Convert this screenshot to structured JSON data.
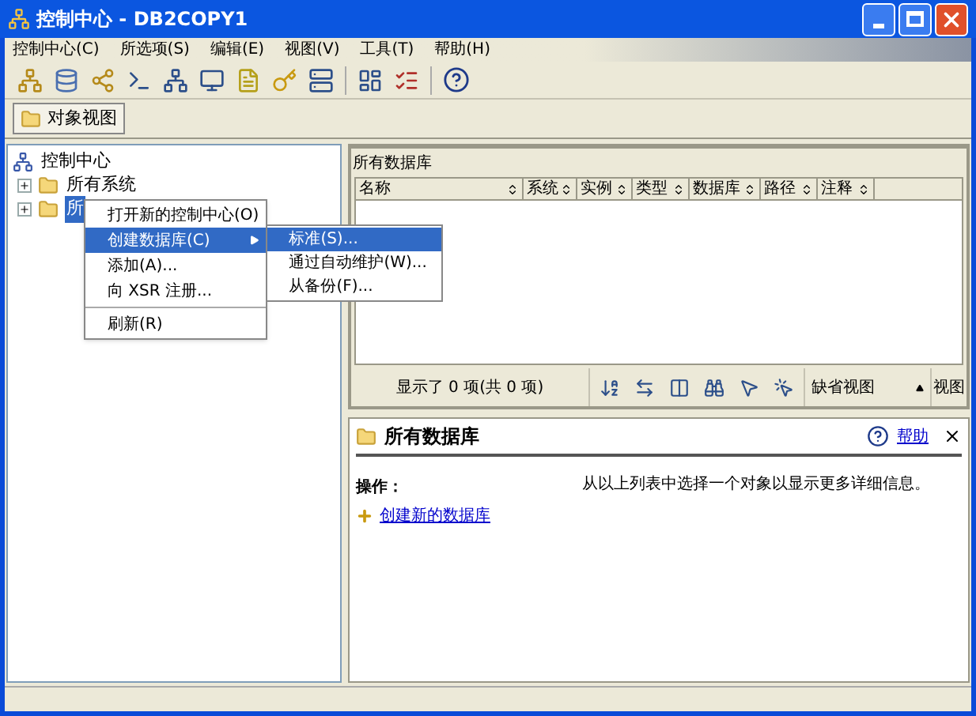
{
  "window": {
    "title": "控制中心 - DB2COPY1"
  },
  "menu_bar": [
    "控制中心(C)",
    "所选项(S)",
    "编辑(E)",
    "视图(V)",
    "工具(T)",
    "帮助(H)"
  ],
  "view_button": {
    "label": "对象视图"
  },
  "tree": {
    "label": "控制中心",
    "children": [
      {
        "label": "所有系统",
        "expanded": false,
        "selected": false
      },
      {
        "label": "所",
        "expanded": false,
        "selected": true
      }
    ]
  },
  "context_menu": {
    "groups": [
      [
        {
          "label": "打开新的控制中心(O)",
          "selected": false,
          "submenu": false
        },
        {
          "label": "创建数据库(C)",
          "selected": true,
          "submenu": true
        },
        {
          "label": "添加(A)...",
          "selected": false,
          "submenu": false
        },
        {
          "label": "向 XSR 注册...",
          "selected": false,
          "submenu": false
        }
      ],
      [
        {
          "label": "刷新(R)",
          "selected": false,
          "submenu": false
        }
      ]
    ]
  },
  "submenu": [
    {
      "label": "标准(S)...",
      "selected": true
    },
    {
      "label": "通过自动维护(W)...",
      "selected": false
    },
    {
      "label": "从备份(F)...",
      "selected": false
    }
  ],
  "list_panel": {
    "title": "所有数据库",
    "columns": [
      "名称",
      "系统",
      "实例",
      "类型",
      "数据库",
      "路径",
      "注释"
    ],
    "status": "显示了 0 项(共 0 项)",
    "view_select": "缺省视图",
    "view_button": "视图"
  },
  "details": {
    "title": "所有数据库",
    "help": "帮助",
    "actions_label": "操作：",
    "action_link": "创建新的数据库",
    "hint": "从以上列表中选择一个对象以显示更多详细信息。"
  }
}
